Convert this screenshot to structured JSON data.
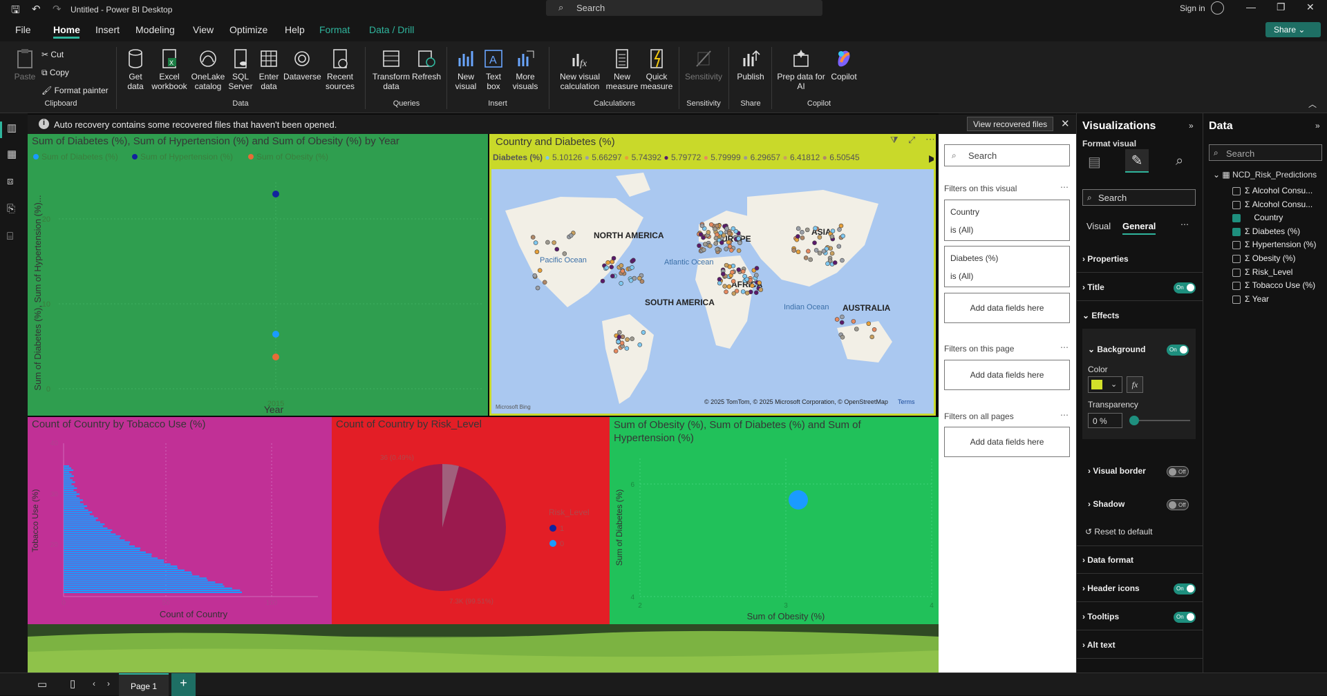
{
  "app": {
    "title": "Untitled - Power BI Desktop",
    "search_placeholder": "Search",
    "signin": "Sign in",
    "share": "Share"
  },
  "menu": [
    "File",
    "Home",
    "Insert",
    "Modeling",
    "View",
    "Optimize",
    "Help",
    "Format",
    "Data / Drill"
  ],
  "ribbon": {
    "clipboard": {
      "paste": "Paste",
      "cut": "Cut",
      "copy": "Copy",
      "format_painter": "Format painter",
      "group": "Clipboard"
    },
    "data": {
      "items": [
        "Get data",
        "Excel workbook",
        "OneLake catalog",
        "SQL Server",
        "Enter data",
        "Dataverse",
        "Recent sources"
      ],
      "group": "Data"
    },
    "queries": {
      "items": [
        "Transform data",
        "Refresh"
      ],
      "group": "Queries"
    },
    "insert": {
      "items": [
        "New visual",
        "Text box",
        "More visuals"
      ],
      "group": "Insert"
    },
    "calculations": {
      "items": [
        "New visual calculation",
        "New measure",
        "Quick measure"
      ],
      "group": "Calculations"
    },
    "sensitivity": {
      "items": [
        "Sensitivity"
      ],
      "group": "Sensitivity"
    },
    "share": {
      "items": [
        "Publish"
      ],
      "group": "Share"
    },
    "copilot": {
      "items": [
        "Prep data for AI",
        "Copilot"
      ],
      "group": "Copilot"
    }
  },
  "notification": {
    "text": "Auto recovery contains some recovered files that haven't been opened.",
    "button": "View recovered files"
  },
  "visual1": {
    "title": "Sum of Diabetes (%), Sum of Hypertension (%) and Sum of Obesity (%) by Year",
    "legend": [
      "Sum of Diabetes (%)",
      "Sum of Hypertension (%)",
      "Sum of Obesity (%)"
    ],
    "ylabel": "Sum of Diabetes (%), Sum of Hypertension (%)...",
    "xlabel": "Year",
    "yticks": [
      "20",
      "10",
      "0"
    ],
    "xtick": "2015"
  },
  "visual2": {
    "title": "Country and Diabetes (%)",
    "legend_title": "Diabetes (%)",
    "legend": [
      "5.10126",
      "5.66297",
      "5.74392",
      "5.79772",
      "5.79999",
      "6.29657",
      "6.41812",
      "6.50545"
    ],
    "labels": {
      "na": "NORTH AMERICA",
      "eu": "EUROPE",
      "as": "ASIA",
      "af": "AFRICA",
      "sa": "SOUTH AMERICA",
      "au": "AUSTRALIA",
      "pac": "Pacific Ocean",
      "atl": "Atlantic Ocean",
      "ind": "Indian Ocean"
    },
    "attribution": "© 2025 TomTom, © 2025 Microsoft Corporation, © OpenStreetMap",
    "terms": "Terms",
    "bing": "Microsoft Bing"
  },
  "visual3": {
    "title": "Count of Country by Tobacco Use (%)",
    "ylabel": "Tobacco Use (%)",
    "xlabel": "Count of Country",
    "yticks": [
      "40",
      "30",
      "20",
      "10"
    ],
    "xticks": [
      "0",
      "50",
      "100"
    ]
  },
  "visual4": {
    "title": "Count of Country by Risk_Level",
    "legend_title": "Risk_Level",
    "legend": [
      "1",
      "0"
    ],
    "label_top": "36 (0.49%)",
    "label_bottom": "7.3K (99.51%)"
  },
  "visual5": {
    "title": "Sum of Obesity (%), Sum of Diabetes (%) and Sum of Hypertension (%)",
    "ylabel": "Sum of Diabetes (%)",
    "xlabel": "Sum of Obesity (%)",
    "yticks": [
      "6",
      "4"
    ],
    "xticks": [
      "2",
      "3",
      "4"
    ]
  },
  "filters": {
    "search": "Search",
    "on_visual": "Filters on this visual",
    "f1_name": "Country",
    "f1_val": "is (All)",
    "f2_name": "Diabetes (%)",
    "f2_val": "is (All)",
    "add": "Add data fields here",
    "on_page": "Filters on this page",
    "on_all": "Filters on all pages"
  },
  "viz": {
    "title": "Visualizations",
    "format_visual": "Format visual",
    "search": "Search",
    "tab_visual": "Visual",
    "tab_general": "General",
    "sections": [
      "Properties",
      "Title",
      "Effects",
      "Background",
      "Visual border",
      "Shadow",
      "Reset to default",
      "Data format",
      "Header icons",
      "Tooltips",
      "Alt text"
    ],
    "color_label": "Color",
    "transparency_label": "Transparency",
    "transparency": "0 %",
    "on": "On",
    "off": "Off",
    "bg_color": "#d3e02a"
  },
  "data": {
    "title": "Data",
    "search": "Search",
    "table": "NCD_Risk_Predictions",
    "fields": [
      {
        "name": "Alcohol Consu...",
        "sigma": true,
        "checked": false
      },
      {
        "name": "Alcohol Consu...",
        "sigma": true,
        "checked": false
      },
      {
        "name": "Country",
        "sigma": false,
        "checked": true
      },
      {
        "name": "Diabetes (%)",
        "sigma": true,
        "checked": true
      },
      {
        "name": "Hypertension (%)",
        "sigma": true,
        "checked": false
      },
      {
        "name": "Obesity (%)",
        "sigma": true,
        "checked": false
      },
      {
        "name": "Risk_Level",
        "sigma": true,
        "checked": false
      },
      {
        "name": "Tobacco Use (%)",
        "sigma": true,
        "checked": false
      },
      {
        "name": "Year",
        "sigma": true,
        "checked": false
      }
    ]
  },
  "pages": {
    "tab": "Page 1"
  },
  "colors": {
    "accent": "#2fb59d",
    "v1_bg": "#2f9e4f",
    "v2_bg": "#c9d92a",
    "v3_bg": "#c13096",
    "v4_bg": "#e31e26",
    "v5_bg": "#21c15a"
  }
}
